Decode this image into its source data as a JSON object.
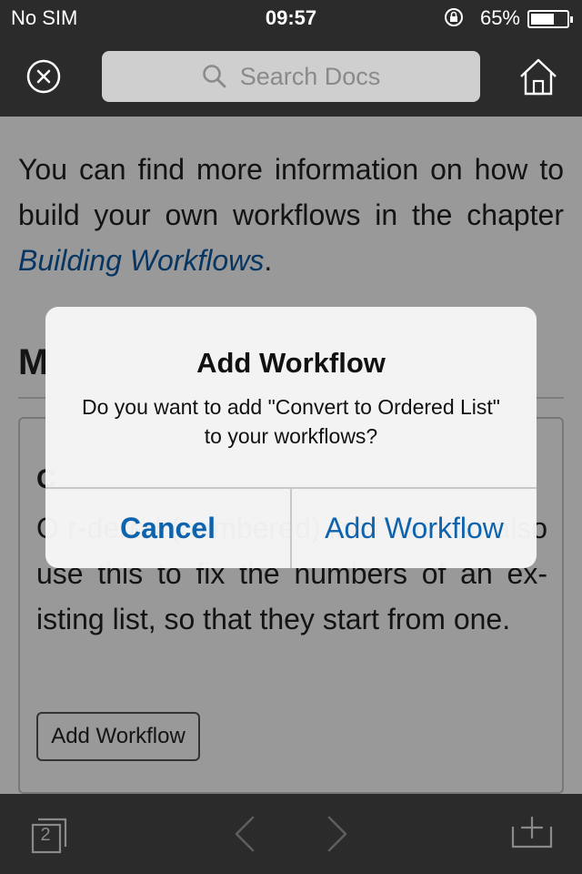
{
  "status_bar": {
    "carrier": "No SIM",
    "time": "09:57",
    "battery_percent": "65%",
    "battery_level": 0.65
  },
  "nav": {
    "close_icon": "close-circle-icon",
    "search_placeholder": "Search Docs",
    "home_icon": "home-icon"
  },
  "content": {
    "paragraph_before": "You can find more information on how to build your own workflows in the chapter ",
    "paragraph_link": "Building Workflows",
    "paragraph_after": ".",
    "section_heading": "M",
    "card_title": "C",
    "card_text": "O                                                              r-dered (numbered) list. You can also use this to fix the numbers of an ex-isting list, so that they start from one.",
    "card_button": "Add Workflow"
  },
  "dialog": {
    "title": "Add Workflow",
    "message": "Do you want to add \"Convert to Ordered List\" to your workflows?",
    "cancel_label": "Cancel",
    "confirm_label": "Add Workflow"
  },
  "toolbar": {
    "tab_count": "2",
    "tabs_icon": "tabs-icon",
    "back_icon": "chevron-left-icon",
    "forward_icon": "chevron-right-icon",
    "add_icon": "add-tray-icon"
  },
  "colors": {
    "bar_background": "#2b2b2c",
    "accent": "#0e63ad",
    "link": "#0d5aa6"
  }
}
